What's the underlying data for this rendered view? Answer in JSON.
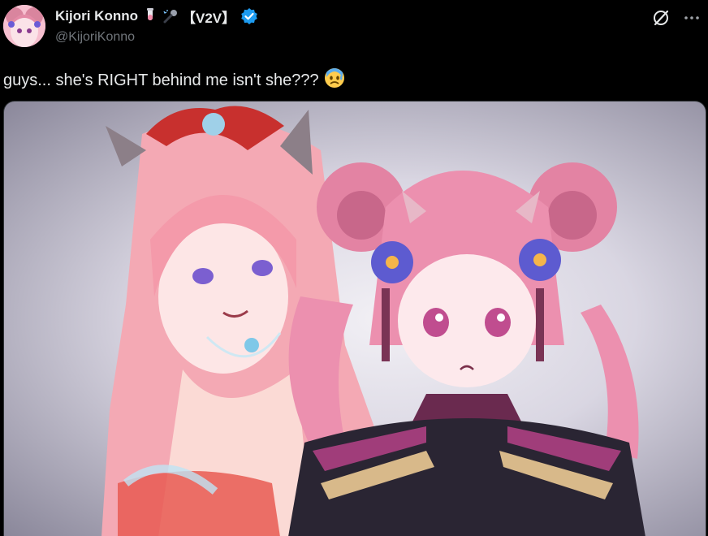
{
  "author": {
    "display_name": "Kijori Konno",
    "emoji_decor": [
      "tube-emoji",
      "microphone-emoji"
    ],
    "tag": "【V2V】",
    "handle": "@KijoriKonno",
    "verified": true
  },
  "tweet": {
    "text": "guys... she's RIGHT behind me isn't she???",
    "emoji": "anxious-face-with-sweat"
  },
  "actions": {
    "grok_icon": "grok-icon",
    "more_icon": "more-icon"
  },
  "colors": {
    "background": "#000000",
    "text": "#e7e9ea",
    "secondary_text": "#71767b",
    "verified_blue": "#1d9bf0"
  }
}
